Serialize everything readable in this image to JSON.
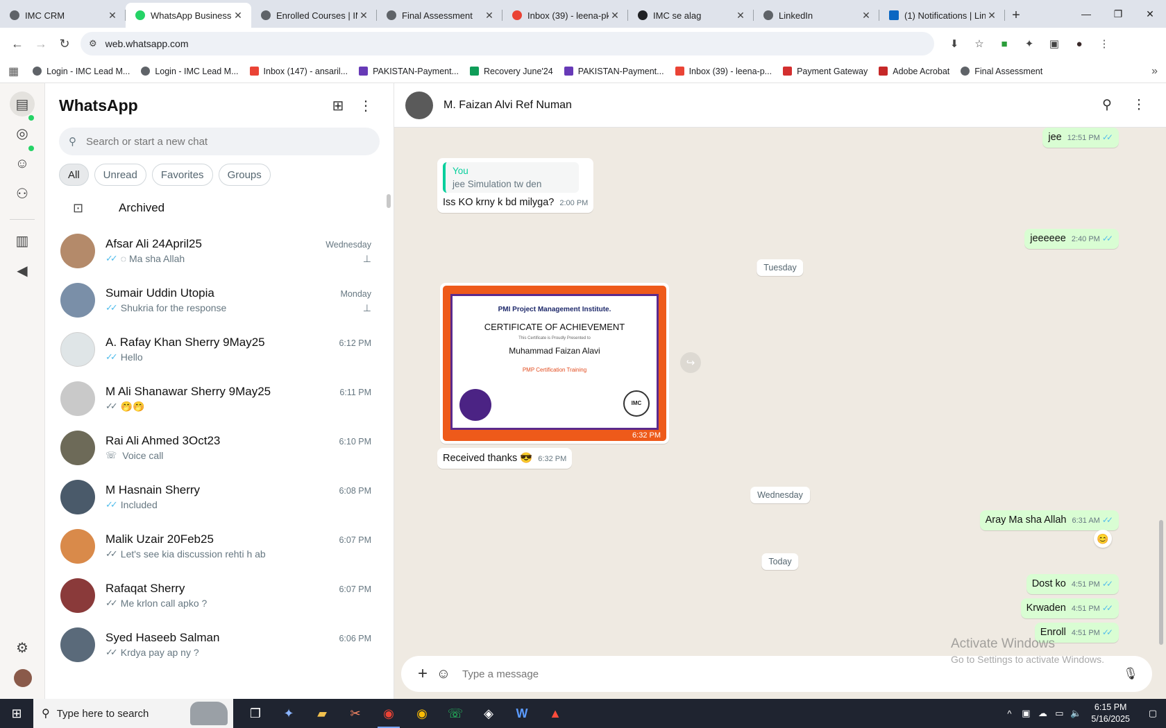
{
  "browser": {
    "tabs": [
      {
        "title": "IMC CRM",
        "color": "#5f6368"
      },
      {
        "title": "WhatsApp Business",
        "color": "#25d366",
        "active": true
      },
      {
        "title": "Enrolled Courses | IM",
        "color": "#5f6368"
      },
      {
        "title": "Final Assessment",
        "color": "#5f6368"
      },
      {
        "title": "Inbox (39) - leena-pk",
        "color": "#ea4335"
      },
      {
        "title": "IMC se alag",
        "color": "#202124"
      },
      {
        "title": "LinkedIn",
        "color": "#5f6368"
      },
      {
        "title": "(1) Notifications | Lin",
        "color": "#0a66c2"
      }
    ],
    "close_glyph": "✕",
    "new_tab": "+",
    "window_controls": {
      "minimize": "—",
      "restore": "❐",
      "close": "✕"
    },
    "nav": {
      "back": "←",
      "forward": "→",
      "reload": "↻",
      "site_info": "⚙"
    },
    "url": "web.whatsapp.com",
    "toolbar_icons": {
      "install": "⬇",
      "star": "☆",
      "ext1": "■",
      "extensions": "✦",
      "sidebar": "▣",
      "profile": "●",
      "menu": "⋮"
    },
    "bookmarks": [
      {
        "label": "Login - IMC Lead M...",
        "color": "#5f6368"
      },
      {
        "label": "Login - IMC Lead M...",
        "color": "#5f6368"
      },
      {
        "label": "Inbox (147) - ansaril...",
        "color": "#ea4335"
      },
      {
        "label": "PAKISTAN-Payment...",
        "color": "#673ab7"
      },
      {
        "label": "Recovery June'24",
        "color": "#0f9d58"
      },
      {
        "label": "PAKISTAN-Payment...",
        "color": "#673ab7"
      },
      {
        "label": "Inbox (39) - leena-p...",
        "color": "#ea4335"
      },
      {
        "label": "Payment Gateway",
        "color": "#d32f2f"
      },
      {
        "label": "Adobe Acrobat",
        "color": "#c62828"
      },
      {
        "label": "Final Assessment",
        "color": "#5f6368"
      }
    ],
    "apps_icon": "▦",
    "more_icon": "»"
  },
  "rail": {
    "chats": "▤",
    "status": "◎",
    "channels": "☺",
    "communities": "⚇",
    "catalog": "▥",
    "ads": "◀",
    "settings": "⚙"
  },
  "chatlist": {
    "title": "WhatsApp",
    "new_chat_icon": "⊞",
    "menu_icon": "⋮",
    "search_icon": "⚲",
    "search_placeholder": "Search or start a new chat",
    "filters": [
      "All",
      "Unread",
      "Favorites",
      "Groups"
    ],
    "archived_icon": "⊡",
    "archived_label": "Archived",
    "pin_icon": "⊥",
    "chats": [
      {
        "name": "Afsar Ali 24April25",
        "time": "Wednesday",
        "tick": "✓✓",
        "preview": "◌ Ma sha Allah",
        "pinned": true,
        "avatar": "#b48a6a"
      },
      {
        "name": "Sumair Uddin Utopia",
        "time": "Monday",
        "tick": "✓✓",
        "preview": "Shukria for the response",
        "pinned": true,
        "avatar": "#7a8fa8"
      },
      {
        "name": "A. Rafay Khan Sherry 9May25",
        "time": "6:12 PM",
        "tick": "✓✓",
        "preview": "Hello",
        "pinned": false,
        "avatar": "#dfe5e7"
      },
      {
        "name": "M Ali Shanawar Sherry 9May25",
        "time": "6:11 PM",
        "tick": "✓✓",
        "preview": "🤭🤭",
        "pinned": false,
        "avatar": "#c9c9c9"
      },
      {
        "name": "Rai Ali Ahmed 3Oct23",
        "time": "6:10 PM",
        "tick": "☏",
        "preview": "Voice call",
        "pinned": false,
        "avatar": "#6d6a58"
      },
      {
        "name": "M Hasnain Sherry",
        "time": "6:08 PM",
        "tick": "✓✓",
        "preview": "Included",
        "pinned": false,
        "avatar": "#4a5a6a"
      },
      {
        "name": "Malik Uzair 20Feb25",
        "time": "6:07 PM",
        "tick": "✓✓",
        "preview": "Let's see kia discussion rehti h ab",
        "pinned": false,
        "avatar": "#d98a4a"
      },
      {
        "name": "Rafaqat Sherry",
        "time": "6:07 PM",
        "tick": "✓✓",
        "preview": "Me krlon call apko ?",
        "pinned": false,
        "avatar": "#8a3a3a"
      },
      {
        "name": "Syed Haseeb Salman",
        "time": "6:06 PM",
        "tick": "✓✓",
        "preview": "Krdya pay ap ny ?",
        "pinned": false,
        "avatar": "#5a6a7a"
      }
    ]
  },
  "conversation": {
    "contact_name": "M. Faizan Alvi Ref Numan",
    "search_icon": "⚲",
    "menu_icon": "⋮",
    "messages": {
      "m1": {
        "text": "jee",
        "time": "12:51 PM",
        "tick": "✓✓"
      },
      "m2": {
        "quote_from": "You",
        "quote_text": "jee Simulation tw den",
        "text": "Iss KO krny k bd milyga?",
        "time": "2:00 PM"
      },
      "m3": {
        "text": "jeeeeee",
        "time": "2:40 PM",
        "tick": "✓✓"
      },
      "day1": "Tuesday",
      "cert": {
        "logo": "PMI Project Management Institute.",
        "title": "CERTIFICATE OF ACHIEVEMENT",
        "sub": "This Certificate is Proudly Presented to",
        "name": "Muhammad Faizan Alavi",
        "course": "PMP Certification Training",
        "seal": "IMC",
        "time": "6:32 PM"
      },
      "forward_icon": "↪",
      "m4": {
        "text": "Received thanks 😎",
        "time": "6:32 PM"
      },
      "day2": "Wednesday",
      "m5": {
        "text": "Aray Ma sha Allah",
        "time": "6:31 AM",
        "tick": "✓✓",
        "reaction": "😊"
      },
      "day3": "Today",
      "m6": {
        "text": "Dost ko",
        "time": "4:51 PM",
        "tick": "✓✓"
      },
      "m7": {
        "text": "Krwaden",
        "time": "4:51 PM",
        "tick": "✓✓"
      },
      "m8": {
        "text": "Enroll",
        "time": "4:51 PM",
        "tick": "✓✓"
      }
    },
    "composer": {
      "plus_icon": "+",
      "emoji_icon": "☺",
      "placeholder": "Type a message",
      "mic_icon": "🎙"
    },
    "watermark": {
      "line1": "Activate Windows",
      "line2": "Go to Settings to activate Windows."
    }
  },
  "taskbar": {
    "start_icon": "⊞",
    "search_icon": "⚲",
    "search_placeholder": "Type here to search",
    "apps": [
      "❐",
      "✦",
      "▰",
      "✂",
      "◉",
      "◉",
      "☏",
      "◈",
      "W",
      "▲"
    ],
    "tray": {
      "chevron": "^",
      "icons": [
        "▣",
        "☁",
        "▭",
        "🔈"
      ],
      "time": "6:15 PM",
      "date": "5/16/2025",
      "notif": "▢"
    }
  }
}
